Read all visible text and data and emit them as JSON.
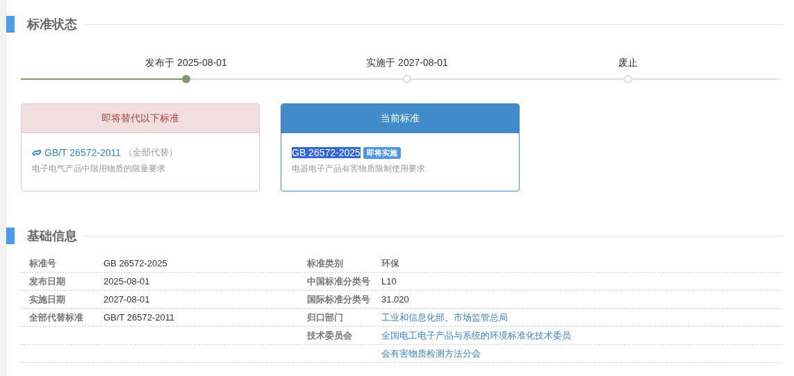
{
  "status_section": {
    "title": "标准状态",
    "timeline": [
      {
        "label": "发布于 2025-08-01",
        "done": true
      },
      {
        "label": "实施于 2027-08-01",
        "done": false
      },
      {
        "label": "废止",
        "done": false
      }
    ],
    "cards": [
      {
        "kind": "replaced",
        "header": "即将替代以下标准",
        "code": "GB/T 26572-2011",
        "note": "（全部代替）",
        "name": "电子电气产品中限用物质的限量要求",
        "selected": false
      },
      {
        "kind": "current",
        "header": "当前标准",
        "code": "GB 26572-2025",
        "badge": "即将实施",
        "name": "电器电子产品有害物质限制使用要求",
        "selected": true
      }
    ]
  },
  "info_section": {
    "title": "基础信息",
    "left": [
      {
        "label": "标准号",
        "value": "GB 26572-2025"
      },
      {
        "label": "发布日期",
        "value": "2025-08-01"
      },
      {
        "label": "实施日期",
        "value": "2027-08-01"
      },
      {
        "label": "全部代替标准",
        "value": "GB/T 26572-2011"
      }
    ],
    "right": [
      {
        "label": "标准类别",
        "value": "环保"
      },
      {
        "label": "中国标准分类号",
        "value": "L10"
      },
      {
        "label": "国际标准分类号",
        "value": "31.020"
      },
      {
        "label": "归口部门",
        "links": [
          "工业和信息化部",
          "市场监管总局"
        ],
        "separator": "、"
      },
      {
        "label": "技术委员会",
        "links": [
          "全国电工电子产品与系统的环境标准化技术委员会有害物质检测方法分会"
        ]
      }
    ]
  }
}
